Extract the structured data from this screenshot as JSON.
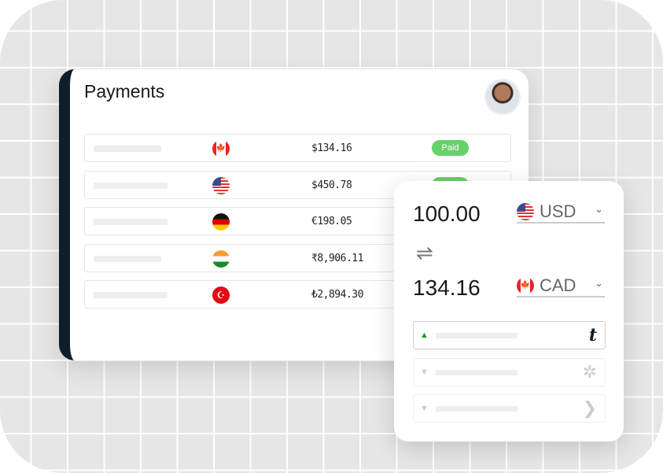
{
  "payments": {
    "title": "Payments",
    "rows": [
      {
        "flag": "canada-flag",
        "amount": "$134.16",
        "status": "Paid"
      },
      {
        "flag": "usa-flag",
        "amount": "$450.78",
        "status": "Paid"
      },
      {
        "flag": "germany-flag",
        "amount": "€198.05"
      },
      {
        "flag": "india-flag",
        "amount": "₹8,906.11"
      },
      {
        "flag": "turkey-flag",
        "amount": "₺2,894.30"
      }
    ]
  },
  "converter": {
    "from_amount": "100.00",
    "from_currency": "USD",
    "to_amount": "134.16",
    "to_currency": "CAD",
    "providers": [
      {
        "logo": "t",
        "selected": true
      },
      {
        "logo": "provider-2"
      },
      {
        "logo": "provider-3"
      }
    ]
  },
  "colors": {
    "paid": "#68d06a",
    "sidebar": "#0e1e2b",
    "up": "#1a9a1a"
  }
}
